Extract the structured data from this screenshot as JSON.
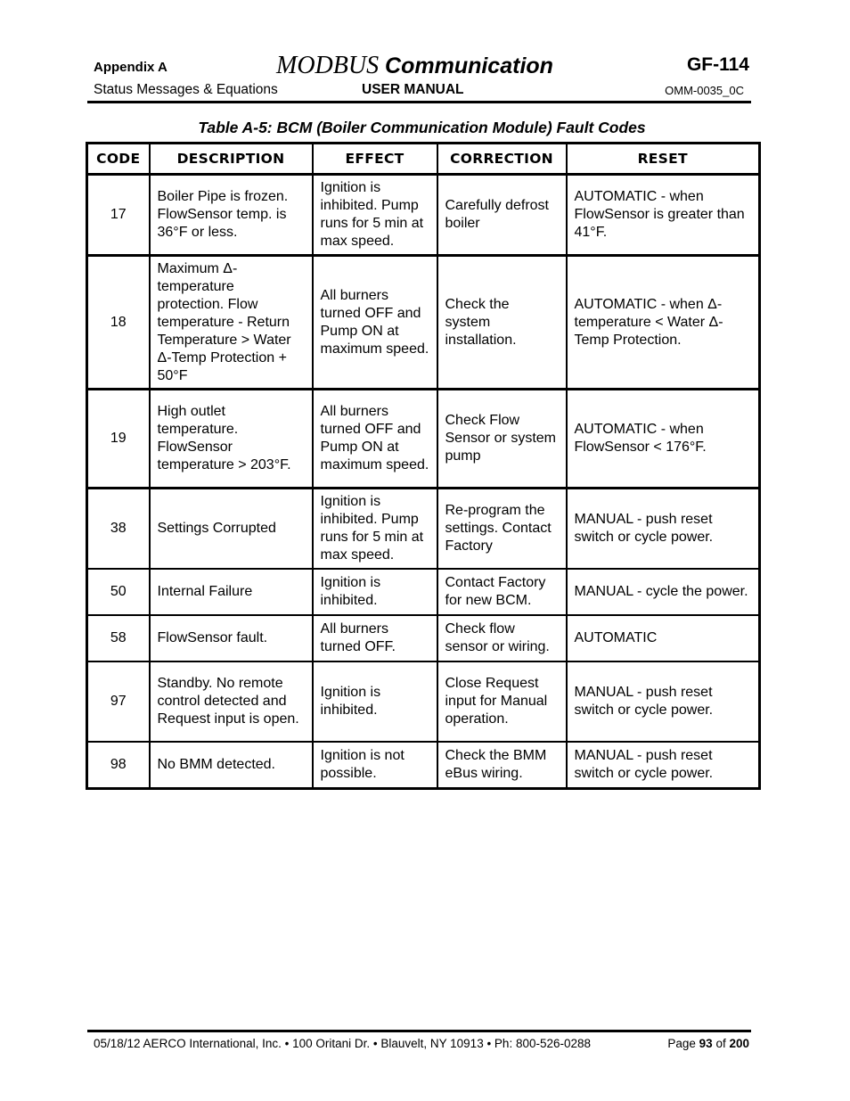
{
  "header": {
    "appendix": "Appendix A",
    "title_modbus": "MODBUS",
    "title_rest": " Communication",
    "model": "GF-114",
    "subtitle": "Status Messages & Equations",
    "manual": "USER MANUAL",
    "doc_number": "OMM-0035_0C"
  },
  "table": {
    "caption": "Table A-5:  BCM (Boiler Communication Module) Fault Codes",
    "columns": [
      "CODE",
      "DESCRIPTION",
      "EFFECT",
      "CORRECTION",
      "RESET"
    ],
    "rows": [
      {
        "code": "17",
        "description": "Boiler Pipe is frozen. FlowSensor temp. is 36°F or less.",
        "effect": "Ignition is inhibited. Pump runs for 5 min at max speed.",
        "correction": "Carefully defrost boiler",
        "reset": "AUTOMATIC - when FlowSensor is greater than 41°F."
      },
      {
        "code": "18",
        "description": "Maximum Δ-temperature protection.  Flow temperature - Return Temperature > Water Δ-Temp Protection + 50°F",
        "effect": "All burners turned OFF and Pump ON at maximum speed.",
        "correction": "Check the system installation.",
        "reset": "AUTOMATIC - when Δ-temperature < Water Δ-Temp Protection."
      },
      {
        "code": "19",
        "description": "High outlet temperature. FlowSensor temperature > 203°F.",
        "effect": "All burners turned OFF and Pump ON at maximum speed.",
        "correction": "Check Flow Sensor or system pump",
        "reset": "AUTOMATIC - when FlowSensor < 176°F."
      },
      {
        "code": "38",
        "description": "Settings Corrupted",
        "effect": "Ignition is inhibited. Pump runs for 5 min at max speed.",
        "correction": "Re-program the settings. Contact Factory",
        "reset": "MANUAL - push reset switch or cycle power."
      },
      {
        "code": "50",
        "description": "Internal Failure",
        "effect": "Ignition is inhibited.",
        "correction": "Contact Factory for new BCM.",
        "reset": "MANUAL - cycle the power."
      },
      {
        "code": "58",
        "description": "FlowSensor fault.",
        "effect": "All burners turned OFF.",
        "correction": "Check flow sensor or wiring.",
        "reset": "AUTOMATIC"
      },
      {
        "code": "97",
        "description": "Standby.  No remote control detected and Request input is open.",
        "effect": "Ignition is inhibited.",
        "correction": "Close Request input for Manual operation.",
        "reset": "MANUAL - push reset switch or cycle power."
      },
      {
        "code": "98",
        "description": "No BMM detected.",
        "effect": "Ignition is not possible.",
        "correction": "Check the BMM eBus wiring.",
        "reset": "MANUAL - push reset switch or cycle power."
      }
    ]
  },
  "footer": {
    "left": "05/18/12  AERCO International, Inc. • 100 Oritani Dr. •  Blauvelt, NY 10913 • Ph: 800-526-0288",
    "page_label": "Page ",
    "page_number": "93",
    "of_label": " of ",
    "page_total": "200"
  }
}
